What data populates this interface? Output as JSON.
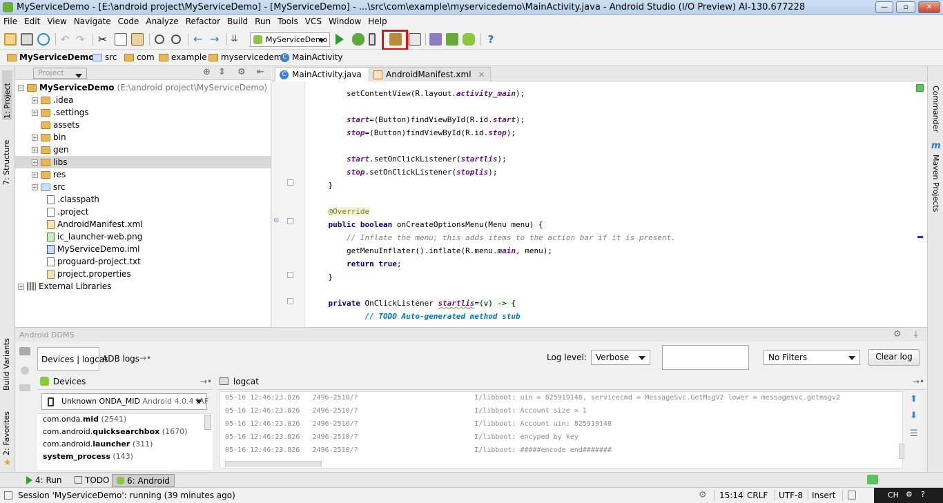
{
  "window": {
    "title": "MyServiceDemo - [E:\\android project\\MyServiceDemo] - [MyServiceDemo] - ...\\src\\com\\example\\myservicedemo\\MainActivity.java - Android Studio (I/O Preview) AI-130.677228"
  },
  "menu": [
    "File",
    "Edit",
    "View",
    "Navigate",
    "Code",
    "Analyze",
    "Refactor",
    "Build",
    "Run",
    "Tools",
    "VCS",
    "Window",
    "Help"
  ],
  "toolbar": {
    "run_config": "MyServiceDemo"
  },
  "breadcrumbs": [
    "MyServiceDemo",
    "src",
    "com",
    "example",
    "myservicedemo",
    "MainActivity"
  ],
  "left_tabs": {
    "project": "1: Project",
    "structure": "7: Structure",
    "build_variants": "Build Variants",
    "favorites": "2: Favorites"
  },
  "right_tabs": {
    "commander": "Commander",
    "maven": "Maven Projects"
  },
  "project_panel": {
    "view_selector": "Project",
    "root": {
      "name": "MyServiceDemo",
      "path": "(E:\\android project\\MyServiceDemo)"
    },
    "items": [
      ".idea",
      ".settings",
      "assets",
      "bin",
      "gen",
      "libs",
      "res",
      "src",
      ".classpath",
      ".project",
      "AndroidManifest.xml",
      "ic_launcher-web.png",
      "MyServiceDemo.iml",
      "proguard-project.txt",
      "project.properties"
    ],
    "external": "External Libraries"
  },
  "editor": {
    "tabs": [
      "MainActivity.java",
      "AndroidManifest.xml"
    ]
  },
  "ddms": {
    "title": "Android DDMS",
    "tabs": [
      "Devices | logcat",
      "ADB logs"
    ],
    "log_level_label": "Log level:",
    "log_level": "Verbose",
    "search_value": "",
    "filter": "No Filters",
    "clear_label": "Clear log",
    "devices_title": "Devices",
    "device": "Unknown ONDA_MID",
    "device_os": "Android 4.0.4 (AF",
    "processes": [
      {
        "pkg": "com.onda.",
        "bold": "mid",
        "pid": "(2541)"
      },
      {
        "pkg": "com.android.",
        "bold": "quicksearchbox",
        "pid": "(1670)"
      },
      {
        "pkg": "com.android.",
        "bold": "launcher",
        "pid": "(311)"
      },
      {
        "pkg": "",
        "bold": "system_process",
        "pid": "(143)"
      }
    ],
    "logcat_title": "logcat",
    "logs": [
      {
        "time": "05-16 12:46:23.826",
        "pid": "2496-2510/?",
        "msg": "I/libboot: uin = 825919148, servicecmd = MessageSvc.GetMsgV2 lower = messagesvc.getmsgv2"
      },
      {
        "time": "05-16 12:46:23.826",
        "pid": "2496-2510/?",
        "msg": "I/libboot: Account size = 1"
      },
      {
        "time": "05-16 12:46:23.826",
        "pid": "2496-2510/?",
        "msg": "I/libboot: Account uin: 825919148"
      },
      {
        "time": "05-16 12:46:23.826",
        "pid": "2496-2510/?",
        "msg": "I/libboot: encyped by key"
      },
      {
        "time": "05-16 12:46:23.826",
        "pid": "2496-2510/?",
        "msg": "I/libboot: #####encode end#######"
      }
    ]
  },
  "bottom_tabs": {
    "run": "4: Run",
    "todo": "TODO",
    "android": "6: Android"
  },
  "status": {
    "message": "Session 'MyServiceDemo': running (39 minutes ago)",
    "position": "15:14",
    "line_sep": "CRLF",
    "encoding": "UTF-8",
    "mode": "Insert",
    "ime": "CH"
  }
}
